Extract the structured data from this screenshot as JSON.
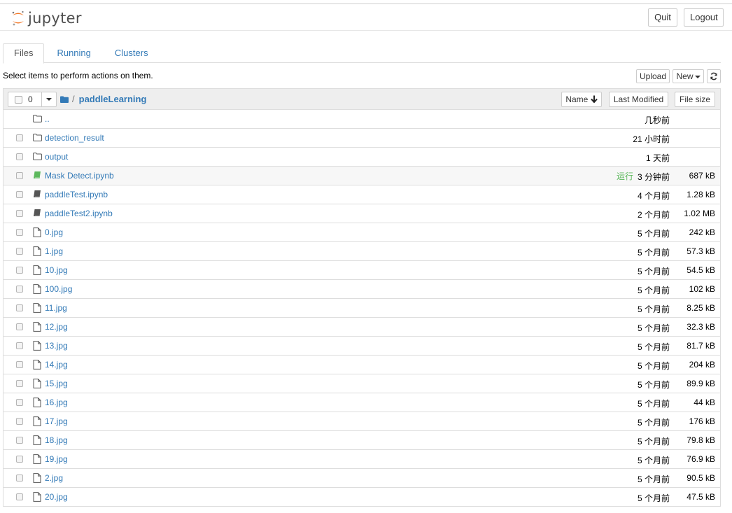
{
  "header": {
    "logo_text": "jupyter",
    "quit_label": "Quit",
    "logout_label": "Logout"
  },
  "tabs": [
    {
      "label": "Files",
      "active": true
    },
    {
      "label": "Running",
      "active": false
    },
    {
      "label": "Clusters",
      "active": false
    }
  ],
  "toolbar": {
    "hint": "Select items to perform actions on them.",
    "upload_label": "Upload",
    "new_label": "New",
    "refresh_icon": "refresh-icon"
  },
  "list_header": {
    "selected_count": "0",
    "breadcrumb_sep": "/",
    "breadcrumb_current": "paddleLearning",
    "sort_name_label": "Name",
    "sort_modified_label": "Last Modified",
    "sort_size_label": "File size"
  },
  "colors": {
    "link": "#337ab7",
    "notebook_running": "#5cb85c",
    "running_status": "#5cb85c"
  },
  "files": [
    {
      "type": "folder",
      "name": "..",
      "modified": "几秒前",
      "size": "",
      "status": ""
    },
    {
      "type": "folder",
      "name": "detection_result",
      "modified": "21 小时前",
      "size": "",
      "status": ""
    },
    {
      "type": "folder",
      "name": "output",
      "modified": "1 天前",
      "size": "",
      "status": ""
    },
    {
      "type": "notebook-running",
      "name": "Mask Detect.ipynb",
      "modified": "3 分钟前",
      "size": "687 kB",
      "status": "运行"
    },
    {
      "type": "notebook",
      "name": "paddleTest.ipynb",
      "modified": "4 个月前",
      "size": "1.28 kB",
      "status": ""
    },
    {
      "type": "notebook",
      "name": "paddleTest2.ipynb",
      "modified": "2 个月前",
      "size": "1.02 MB",
      "status": ""
    },
    {
      "type": "file",
      "name": "0.jpg",
      "modified": "5 个月前",
      "size": "242 kB",
      "status": ""
    },
    {
      "type": "file",
      "name": "1.jpg",
      "modified": "5 个月前",
      "size": "57.3 kB",
      "status": ""
    },
    {
      "type": "file",
      "name": "10.jpg",
      "modified": "5 个月前",
      "size": "54.5 kB",
      "status": ""
    },
    {
      "type": "file",
      "name": "100.jpg",
      "modified": "5 个月前",
      "size": "102 kB",
      "status": ""
    },
    {
      "type": "file",
      "name": "11.jpg",
      "modified": "5 个月前",
      "size": "8.25 kB",
      "status": ""
    },
    {
      "type": "file",
      "name": "12.jpg",
      "modified": "5 个月前",
      "size": "32.3 kB",
      "status": ""
    },
    {
      "type": "file",
      "name": "13.jpg",
      "modified": "5 个月前",
      "size": "81.7 kB",
      "status": ""
    },
    {
      "type": "file",
      "name": "14.jpg",
      "modified": "5 个月前",
      "size": "204 kB",
      "status": ""
    },
    {
      "type": "file",
      "name": "15.jpg",
      "modified": "5 个月前",
      "size": "89.9 kB",
      "status": ""
    },
    {
      "type": "file",
      "name": "16.jpg",
      "modified": "5 个月前",
      "size": "44 kB",
      "status": ""
    },
    {
      "type": "file",
      "name": "17.jpg",
      "modified": "5 个月前",
      "size": "176 kB",
      "status": ""
    },
    {
      "type": "file",
      "name": "18.jpg",
      "modified": "5 个月前",
      "size": "79.8 kB",
      "status": ""
    },
    {
      "type": "file",
      "name": "19.jpg",
      "modified": "5 个月前",
      "size": "76.9 kB",
      "status": ""
    },
    {
      "type": "file",
      "name": "2.jpg",
      "modified": "5 个月前",
      "size": "90.5 kB",
      "status": ""
    },
    {
      "type": "file",
      "name": "20.jpg",
      "modified": "5 个月前",
      "size": "47.5 kB",
      "status": ""
    }
  ]
}
